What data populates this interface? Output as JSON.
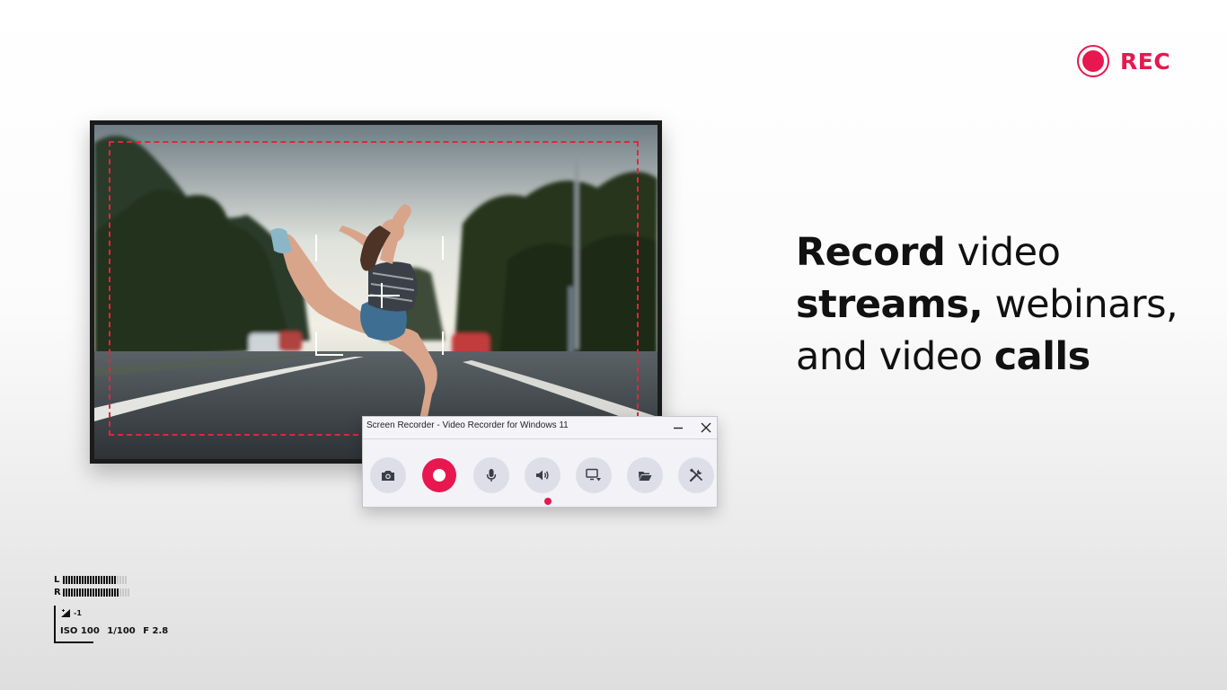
{
  "rec_badge": {
    "label": "REC",
    "color": "#e8174f"
  },
  "headline": {
    "line1_bold": "Record",
    "line1_rest": " video",
    "line2_bold": "streams,",
    "line2_rest": " webinars,",
    "line3_rest": "and video ",
    "line3_bold": "calls"
  },
  "recorder_window": {
    "title": "Screen Recorder - Video Recorder for Windows 11",
    "minimize_icon": "minimize-icon",
    "close_icon": "close-icon",
    "tools": [
      {
        "name": "screenshot",
        "icon": "camera-icon"
      },
      {
        "name": "record",
        "icon": "record-icon"
      },
      {
        "name": "microphone",
        "icon": "microphone-icon"
      },
      {
        "name": "system-audio",
        "icon": "speaker-icon",
        "active": true
      },
      {
        "name": "capture-source",
        "icon": "monitor-dropdown-icon"
      },
      {
        "name": "open-folder",
        "icon": "folder-icon"
      },
      {
        "name": "settings",
        "icon": "tools-icon"
      }
    ],
    "accent": "#e8174f"
  },
  "camera_overlay": {
    "left_channel": "L",
    "right_channel": "R",
    "exposure_compensation": "-1",
    "iso": "ISO 100",
    "shutter": "1/100",
    "aperture": "F 2.8"
  }
}
